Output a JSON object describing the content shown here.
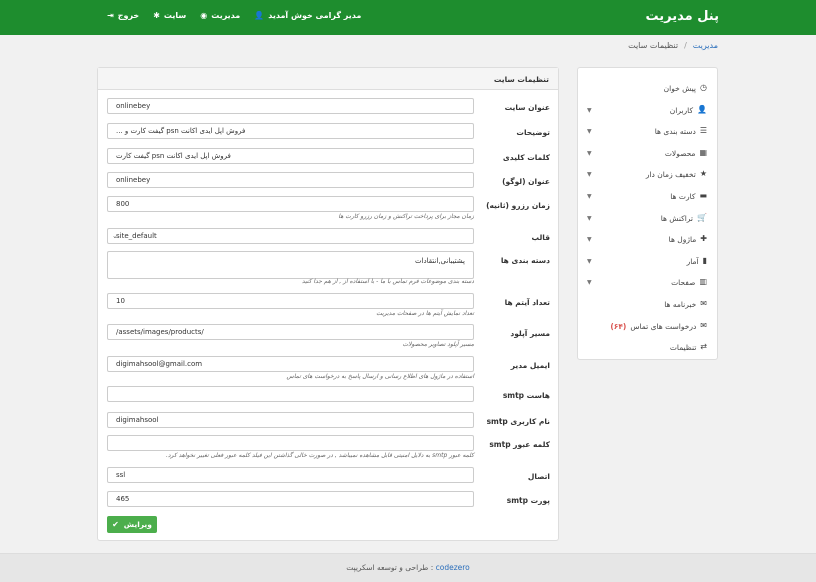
{
  "header": {
    "brand": "پنل مدیریت",
    "welcome": "مدیر گرامی خوش آمدید",
    "admin": "مدیریت",
    "site": "سایت",
    "logout": "خروج"
  },
  "breadcrumb": {
    "home": "مدیریت",
    "current": "تنظیمات سایت"
  },
  "sidebar": {
    "items": [
      {
        "label": "پیش خوان",
        "icon": "dashboard-icon",
        "caret": false
      },
      {
        "label": "کاربران",
        "icon": "user-icon",
        "caret": true
      },
      {
        "label": "دسته بندی ها",
        "icon": "list-icon",
        "caret": true
      },
      {
        "label": "محصولات",
        "icon": "grid-icon",
        "caret": true
      },
      {
        "label": "تخفیف زمان دار",
        "icon": "star-icon",
        "caret": true
      },
      {
        "label": "کارت ها",
        "icon": "card-icon",
        "caret": true
      },
      {
        "label": "تراکنش ها",
        "icon": "cart-icon",
        "caret": true
      },
      {
        "label": "ماژول ها",
        "icon": "plus-icon",
        "caret": true
      },
      {
        "label": "آمار",
        "icon": "chart-icon",
        "caret": true
      },
      {
        "label": "صفحات",
        "icon": "pages-icon",
        "caret": true
      },
      {
        "label": "خبرنامه ها",
        "icon": "mail-icon",
        "caret": false
      },
      {
        "label": "درخواست های تماس",
        "icon": "envelope-icon",
        "caret": false,
        "badge": "(۶۴)"
      },
      {
        "label": "تنظیمات",
        "icon": "settings-icon",
        "caret": false
      }
    ]
  },
  "panel": {
    "title": "تنظیمات سایت",
    "fields": {
      "site_title": {
        "label": "عنوان سایت",
        "value": "onlinebey"
      },
      "description": {
        "label": "توضیحات",
        "value": "فروش اپل ایدی اکانت psn گیفت کارت و ..."
      },
      "keywords": {
        "label": "کلمات کلیدی",
        "value": "فروش اپل ایدی اکانت psn گیفت کارت"
      },
      "logo_title": {
        "label": "عنوان (لوگو)",
        "value": "onlinebey"
      },
      "reserve_time": {
        "label": "زمان رزرو (ثانیه)",
        "value": "800",
        "help": "زمان مجاز برای پرداخت تراکنش و زمان رزرو کارت ها"
      },
      "template": {
        "label": "قالب",
        "value": "site_default"
      },
      "categories": {
        "label": "دسته بندی ها",
        "value": "پشتیبانی,انتقادات",
        "help": "دسته بندی موضوعات فرم تماس با ما - با استفاده از , از هم جدا کنید"
      },
      "items_count": {
        "label": "تعداد آیتم ها",
        "value": "10",
        "help": "تعداد نمایش آیتم ها در صفحات مدیریت"
      },
      "upload_path": {
        "label": "مسیر آپلود",
        "value": "/assets/images/products/",
        "help": "مسیر آپلود تصاویر محصولات"
      },
      "admin_email": {
        "label": "ایمیل مدیر",
        "value": "digimahsool@gmail.com",
        "help": "استفاده در ماژول های اطلاع رسانی و ارسال پاسخ به درخواست های تماس"
      },
      "smtp_host": {
        "label": "هاست smtp",
        "value": ""
      },
      "smtp_user": {
        "label": "نام کاربری smtp",
        "value": "digimahsool"
      },
      "smtp_pass": {
        "label": "کلمه عبور smtp",
        "value": "",
        "help": "کلمه عبور smtp به دلایل امنیتی قابل مشاهده نمیباشد , در صورت خالی گذاشتن این فیلد کلمه عبور فعلی تغییر نخواهد کرد."
      },
      "connection": {
        "label": "اتصال",
        "value": "ssl"
      },
      "smtp_port": {
        "label": "پورت smtp",
        "value": "465"
      }
    },
    "submit": "ویرایش"
  },
  "footer": {
    "text": "طراحی و توسعه اسکریپت :",
    "link": "codezero"
  },
  "colors": {
    "header": "#1e8d2e",
    "button": "#4cae4c",
    "badge": "#d9534f",
    "link": "#2a6ebb"
  }
}
